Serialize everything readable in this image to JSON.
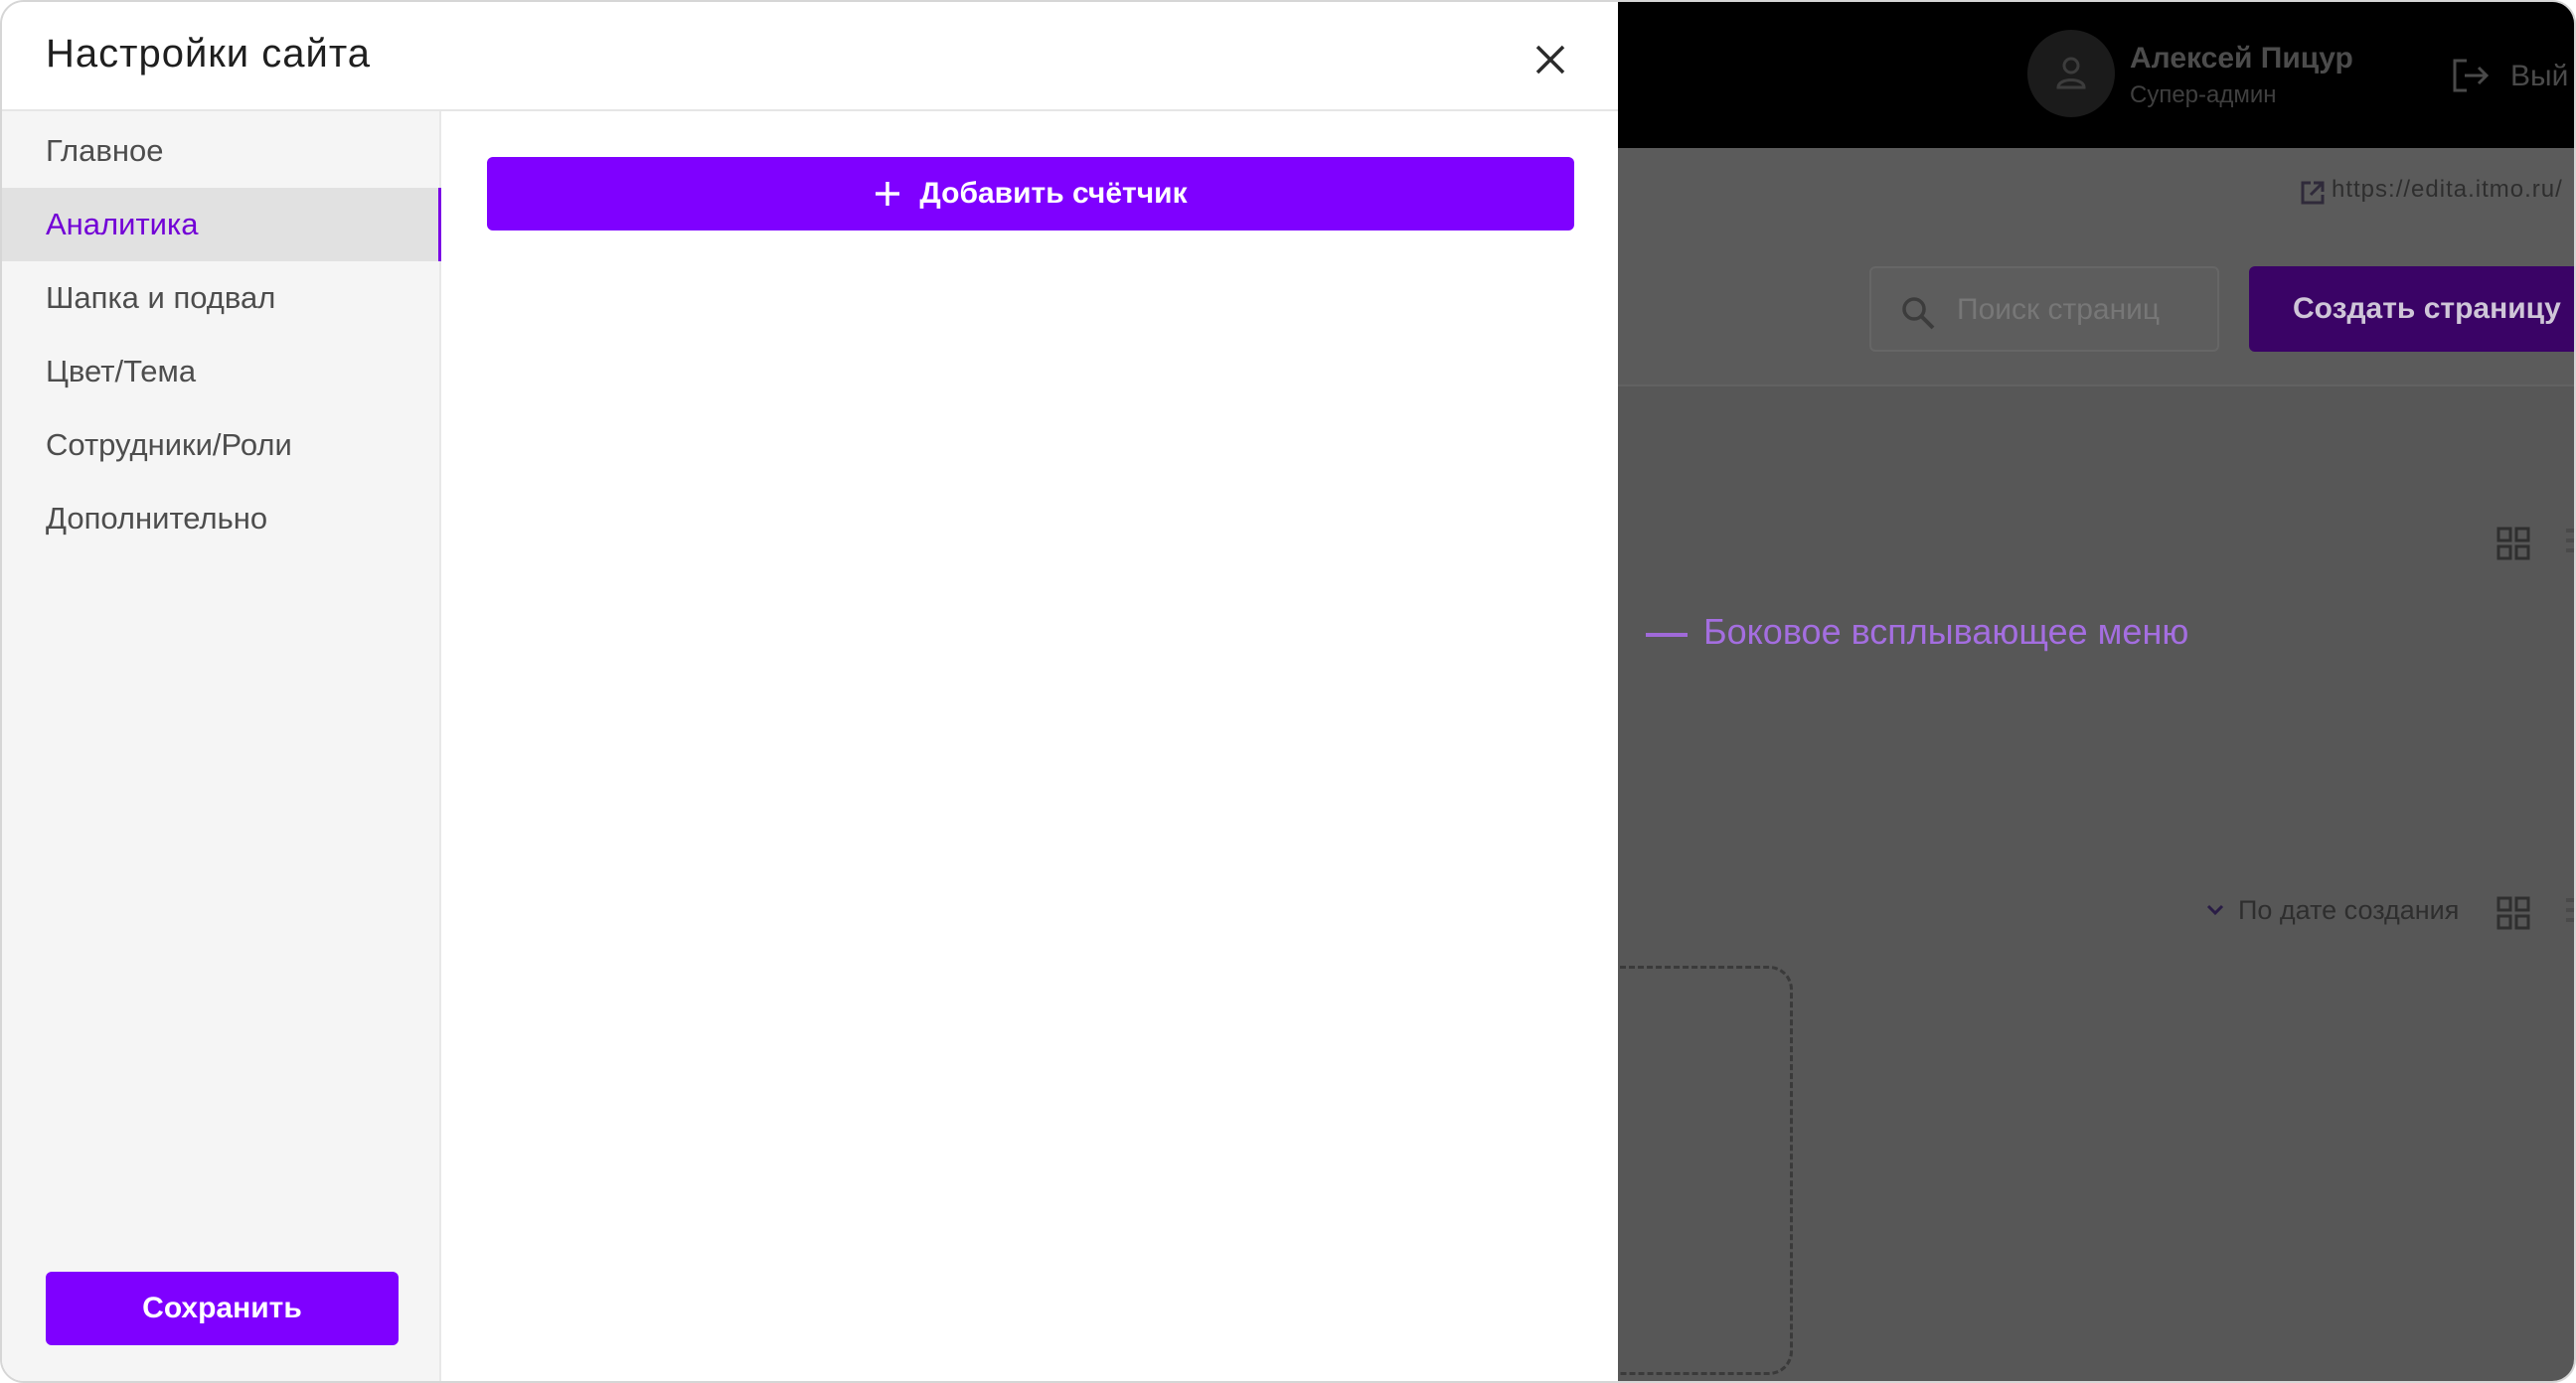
{
  "modal": {
    "title": "Настройки сайта",
    "close_icon": "close-icon",
    "sidebar": {
      "items": [
        {
          "label": "Главное",
          "active": false
        },
        {
          "label": "Аналитика",
          "active": true
        },
        {
          "label": "Шапка и подвал",
          "active": false
        },
        {
          "label": "Цвет/Тема",
          "active": false
        },
        {
          "label": "Сотрудники/Роли",
          "active": false
        },
        {
          "label": "Дополнительно",
          "active": false
        }
      ],
      "save_label": "Сохранить"
    },
    "content": {
      "add_counter_label": "Добавить счётчик",
      "add_icon": "plus-icon"
    }
  },
  "background": {
    "user": {
      "name": "Алексей Пицур",
      "role": "Супер-админ",
      "avatar_icon": "user-icon"
    },
    "logout_label": "Вый",
    "site_link": "https://edita.itmo.ru/",
    "search": {
      "placeholder": "Поиск страниц",
      "icon": "search-icon"
    },
    "create_page_label": "Создать страницу",
    "sort_label": "По дате создания",
    "view_icons": [
      "grid-view-icon",
      "list-view-icon"
    ]
  },
  "annotation": {
    "text": "Боковое всплывающее меню"
  },
  "colors": {
    "accent": "#7F00FF",
    "active_nav_text": "#7200D6",
    "active_nav_bg": "#E1E1E1",
    "sidebar_bg": "#F5F5F5",
    "overlay": "#575757",
    "annotation": "#A46EE0"
  }
}
